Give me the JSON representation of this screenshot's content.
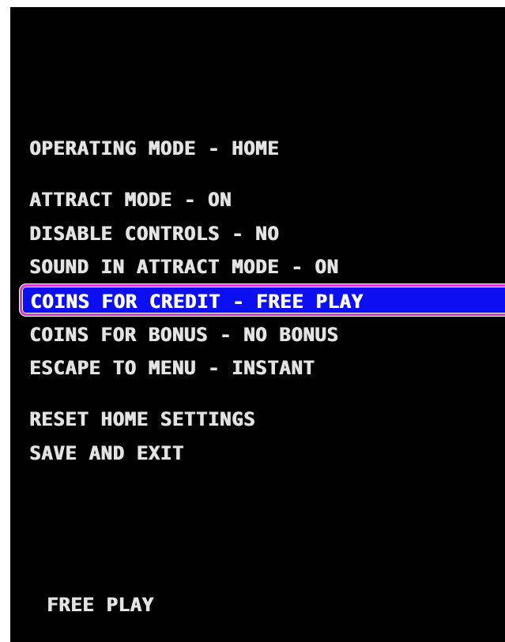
{
  "menu": {
    "operating_mode": "OPERATING MODE - HOME",
    "attract_mode": "ATTRACT MODE - ON",
    "disable_controls": "DISABLE CONTROLS - NO",
    "sound_in_attract_mode": "SOUND IN ATTRACT MODE - ON",
    "coins_for_credit": "COINS FOR CREDIT - FREE PLAY",
    "coins_for_bonus": "COINS FOR BONUS - NO BONUS",
    "escape_to_menu": "ESCAPE TO MENU - INSTANT",
    "reset_home_settings": "RESET HOME SETTINGS",
    "save_and_exit": "SAVE AND EXIT"
  },
  "footer": {
    "status": "FREE PLAY"
  },
  "colors": {
    "background": "#000000",
    "text": "#e3e3e3",
    "highlight_fill": "#0c0ff0",
    "highlight_border": "#d83ad8"
  }
}
